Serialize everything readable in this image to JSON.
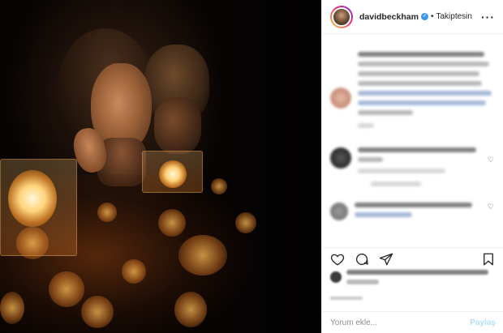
{
  "header": {
    "username": "davidbeckham",
    "separator": "•",
    "follow_status": "Takiptesin",
    "verified_glyph": "✓",
    "more_glyph": "···"
  },
  "actions": {
    "icons": [
      "heart-icon",
      "comment-icon",
      "share-icon",
      "bookmark-icon"
    ]
  },
  "composer": {
    "placeholder": "Yorum ekle...",
    "submit_label": "Paylaş"
  },
  "colors": {
    "accent": "#3897f0",
    "submit_disabled": "#b2dffc",
    "border": "#efefef",
    "text": "#262626",
    "muted": "#8e8e8e"
  }
}
